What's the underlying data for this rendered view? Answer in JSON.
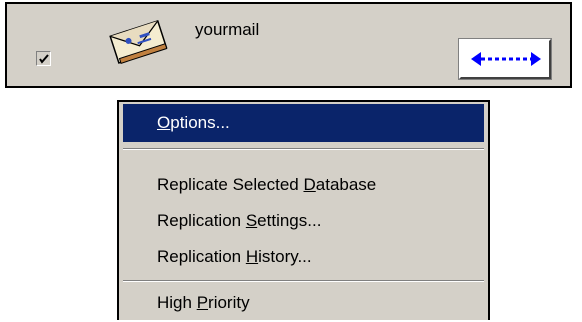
{
  "row": {
    "checked": true,
    "database_name": "yourmail",
    "icon": "envelope-icon",
    "direction_icon": "bidirectional-arrow-icon"
  },
  "menu": {
    "items": [
      {
        "pre": "",
        "accel": "O",
        "post": "ptions...",
        "selected": true
      },
      {
        "pre": "Replicate Selected ",
        "accel": "D",
        "post": "atabase",
        "selected": false
      },
      {
        "pre": "Replication ",
        "accel": "S",
        "post": "ettings...",
        "selected": false
      },
      {
        "pre": "Replication ",
        "accel": "H",
        "post": "istory...",
        "selected": false
      },
      {
        "pre": "High ",
        "accel": "P",
        "post": "riority",
        "selected": false
      }
    ]
  },
  "colors": {
    "menu_highlight": "#0a246a",
    "face": "#d4d0c8",
    "arrow": "#0000ff"
  }
}
